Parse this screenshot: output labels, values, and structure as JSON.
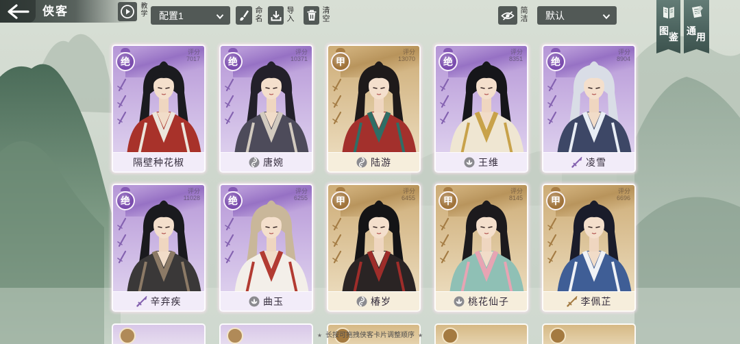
{
  "header": {
    "title": "侠客",
    "back_icon": "back-arrow-icon"
  },
  "toolbar": {
    "tutorial": {
      "icon": "play-circle-icon",
      "label": "教学"
    },
    "config_select": {
      "value": "配置1",
      "icon": "chevron-down-icon"
    },
    "rename": {
      "icon": "brush-icon",
      "label": "命名"
    },
    "import": {
      "icon": "import-icon",
      "label": "导入"
    },
    "clear": {
      "icon": "trash-icon",
      "label": "清空"
    },
    "concise": {
      "icon": "eye-slash-icon",
      "label": "简洁"
    },
    "sort_select": {
      "value": "默认",
      "icon": "chevron-down-icon"
    }
  },
  "side_tabs": [
    {
      "label": "图鉴",
      "icon": "book-icon"
    },
    {
      "label": "通用",
      "icon": "notebook-icon"
    }
  ],
  "score_label": "评分",
  "rank_colors": {
    "绝": {
      "card_top": "#b697d7",
      "card_bottom": "#e3d8f1",
      "plate": "#f2ecf9",
      "badge": "#7a4cae",
      "mark": "#8462b0",
      "ink": "#6b5a80",
      "swoosh": "#8a62bd"
    },
    "甲": {
      "card_top": "#cdac76",
      "card_bottom": "#efe1c5",
      "plate": "#f6eedc",
      "badge": "#a0733a",
      "mark": "#a47c44",
      "ink": "#7a6246",
      "swoosh": "#b08a50"
    }
  },
  "cards": [
    {
      "rank": "绝",
      "score": "7017",
      "name": "隔壁种花椒",
      "portrait": {
        "hair": "#1b1b1f",
        "robe": "#a8322a",
        "trim": "#ece6dc"
      }
    },
    {
      "rank": "绝",
      "score": "10371",
      "name": "唐婉",
      "sect_icon": "swirl-icon",
      "portrait": {
        "hair": "#23202a",
        "robe": "#4d4b5a",
        "trim": "#d2cabf"
      }
    },
    {
      "rank": "甲",
      "score": "13070",
      "name": "陆游",
      "sect_icon": "swirl-icon",
      "portrait": {
        "hair": "#1e1a1a",
        "robe": "#a3302c",
        "trim": "#2f6e66"
      }
    },
    {
      "rank": "绝",
      "score": "8351",
      "name": "王维",
      "sect_icon": "lotus-icon",
      "portrait": {
        "hair": "#16161a",
        "robe": "#efe6d2",
        "trim": "#c8a24a"
      }
    },
    {
      "rank": "绝",
      "score": "8904",
      "name": "凌雪",
      "sect_icon": "sword-icon",
      "portrait": {
        "hair": "#d9dde6",
        "robe": "#3d4766",
        "trim": "#e9eef5"
      }
    },
    {
      "rank": "绝",
      "score": "11028",
      "name": "辛弃疾",
      "sect_icon": "sword-icon",
      "portrait": {
        "hair": "#1a1a1e",
        "robe": "#3a3838",
        "trim": "#8c7a66"
      }
    },
    {
      "rank": "绝",
      "score": "6255",
      "name": "曲玉",
      "sect_icon": "lotus-icon",
      "portrait": {
        "hair": "#c9b79a",
        "robe": "#f3efe9",
        "trim": "#b23b32"
      }
    },
    {
      "rank": "甲",
      "score": "6455",
      "name": "椿岁",
      "sect_icon": "swirl-icon",
      "portrait": {
        "hair": "#141416",
        "robe": "#2a2424",
        "trim": "#9e2d2a"
      }
    },
    {
      "rank": "甲",
      "score": "8145",
      "name": "桃花仙子",
      "sect_icon": "lotus-icon",
      "portrait": {
        "hair": "#1c1a1d",
        "robe": "#8fc0b5",
        "trim": "#e7a4b3"
      }
    },
    {
      "rank": "甲",
      "score": "6696",
      "name": "李佩芷",
      "sect_icon": "sword-icon",
      "portrait": {
        "hair": "#1a1c2a",
        "robe": "#3f5e96",
        "trim": "#f0f2f6"
      }
    }
  ],
  "hint": {
    "text": "长按可拖拽侠客卡片调整顺序",
    "ornament": "★"
  },
  "colors": {
    "toolbar_bg": "#464d4b",
    "header_bg": "#343e3a",
    "tab_bg": "#4a625d",
    "skin": "#f4dfcc"
  }
}
